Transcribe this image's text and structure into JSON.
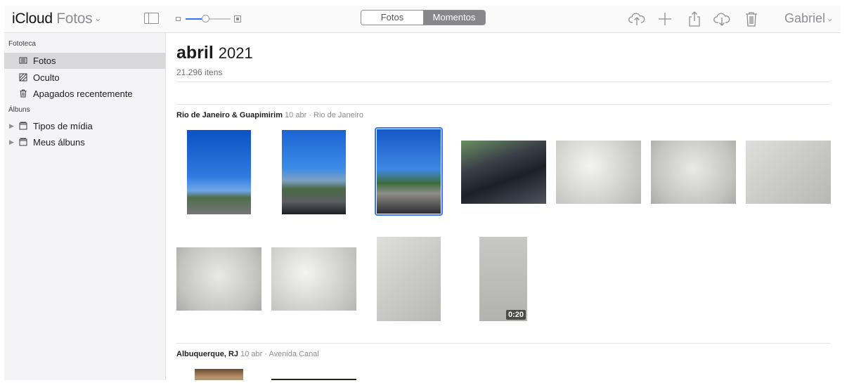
{
  "header": {
    "brand": "iCloud",
    "app_name": "Fotos",
    "view_tabs": [
      "Fotos",
      "Momentos"
    ],
    "selected_tab": "Momentos",
    "user_name": "Gabriel",
    "zoom_level": 0.4,
    "icons": [
      "sidebar-toggle-icon",
      "upload-icon",
      "add-icon",
      "share-icon",
      "download-icon",
      "trash-icon"
    ]
  },
  "sidebar": {
    "library_header": "Fototeca",
    "library_items": [
      {
        "label": "Fotos",
        "icon": "photos-icon",
        "selected": true
      },
      {
        "label": "Oculto",
        "icon": "hidden-icon",
        "selected": false
      },
      {
        "label": "Apagados recentemente",
        "icon": "trash-icon",
        "selected": false
      }
    ],
    "albums_header": "Álbuns",
    "album_items": [
      {
        "label": "Tipos de mídia",
        "icon": "folder-icon"
      },
      {
        "label": "Meus álbuns",
        "icon": "folder-icon"
      }
    ]
  },
  "main": {
    "month": "abril",
    "year": "2021",
    "item_count": "21.296 itens",
    "moments": [
      {
        "title": "Rio de Janeiro & Guapimirim",
        "date": "10 abr",
        "separator": "·",
        "location": "Rio de Janeiro",
        "photos": [
          {
            "kind": "photo",
            "selected": false
          },
          {
            "kind": "photo",
            "selected": false
          },
          {
            "kind": "photo",
            "selected": true
          },
          {
            "kind": "photo",
            "selected": false
          },
          {
            "kind": "photo",
            "selected": false
          },
          {
            "kind": "photo",
            "selected": false
          },
          {
            "kind": "photo",
            "selected": false
          },
          {
            "kind": "photo",
            "selected": false
          },
          {
            "kind": "photo",
            "selected": false
          },
          {
            "kind": "photo",
            "selected": false
          },
          {
            "kind": "video",
            "duration": "0:20",
            "selected": false
          }
        ]
      },
      {
        "title": "Albuquerque, RJ",
        "date": "10 abr",
        "separator": "·",
        "location": "Avenida Canal",
        "photos": [
          {
            "kind": "photo",
            "selected": false
          },
          {
            "kind": "photo",
            "selected": false
          }
        ]
      }
    ]
  },
  "colors": {
    "accent": "#3478f6",
    "segment_selected": "#86868b",
    "sidebar_bg": "#f4f4f6",
    "sidebar_selected": "#d8d8da"
  }
}
